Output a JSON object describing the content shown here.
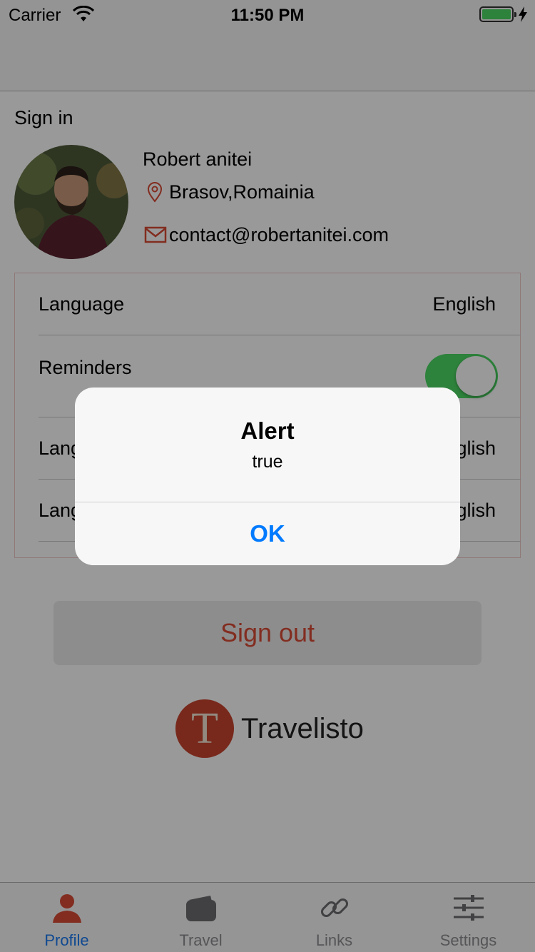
{
  "status_bar": {
    "carrier": "Carrier",
    "time": "11:50 PM"
  },
  "profile": {
    "section_title": "Sign in",
    "name": "Robert anitei",
    "location": "Brasov,Romainia",
    "email": "contact@robertanitei.com"
  },
  "settings": {
    "rows": [
      {
        "label": "Language",
        "value": "English"
      },
      {
        "label": "Reminders",
        "toggle_on": true
      },
      {
        "label": "Language",
        "value": "English"
      },
      {
        "label": "Language",
        "value": "English"
      }
    ]
  },
  "sign_out_label": "Sign out",
  "brand": {
    "logo_letter": "T",
    "name": "Travelisto"
  },
  "tabs": [
    {
      "label": "Profile",
      "icon": "person-icon",
      "active": true
    },
    {
      "label": "Travel",
      "icon": "wallet-icon",
      "active": false
    },
    {
      "label": "Links",
      "icon": "link-icon",
      "active": false
    },
    {
      "label": "Settings",
      "icon": "sliders-icon",
      "active": false
    }
  ],
  "alert": {
    "title": "Alert",
    "message": "true",
    "ok_label": "OK"
  },
  "colors": {
    "accent": "#007aff",
    "brand_red": "#c8452f",
    "signout_text": "#d94b36",
    "toggle_on": "#4cd964",
    "tab_active": "#1b7bf2"
  }
}
